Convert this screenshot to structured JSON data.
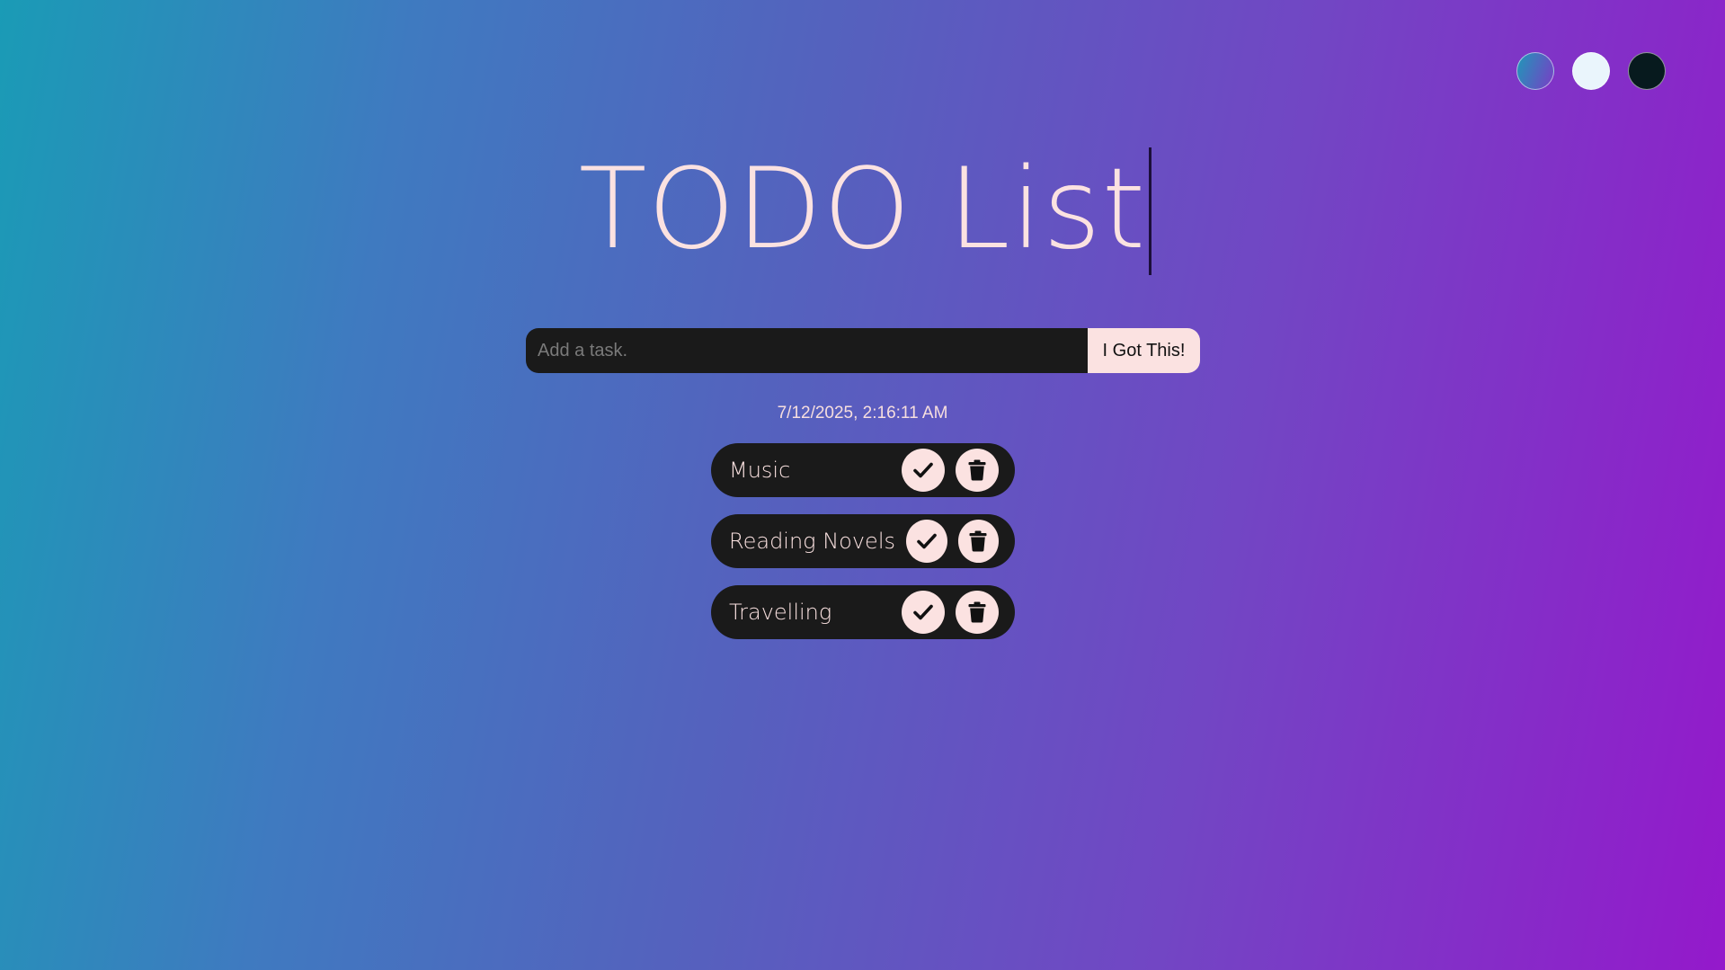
{
  "app": {
    "title": "TODO List"
  },
  "themes": [
    {
      "name": "standard",
      "icon": "gradient-circle"
    },
    {
      "name": "light",
      "icon": "light-circle"
    },
    {
      "name": "darker",
      "icon": "dark-circle"
    }
  ],
  "form": {
    "input_value": "",
    "input_placeholder": "Add a task.",
    "submit_label": "I Got This!"
  },
  "datetime": "7/12/2025, 2:16:11 AM",
  "todos": [
    {
      "text": "Music",
      "complete_icon": "check-icon",
      "delete_icon": "trash-icon"
    },
    {
      "text": "Reading Novels",
      "complete_icon": "check-icon",
      "delete_icon": "trash-icon"
    },
    {
      "text": "Travelling",
      "complete_icon": "check-icon",
      "delete_icon": "trash-icon"
    }
  ],
  "colors": {
    "accent": "#fbe2e1",
    "surface": "#1a1a1a",
    "gradient_start": "#1a9bb6",
    "gradient_end": "#9419cb"
  }
}
